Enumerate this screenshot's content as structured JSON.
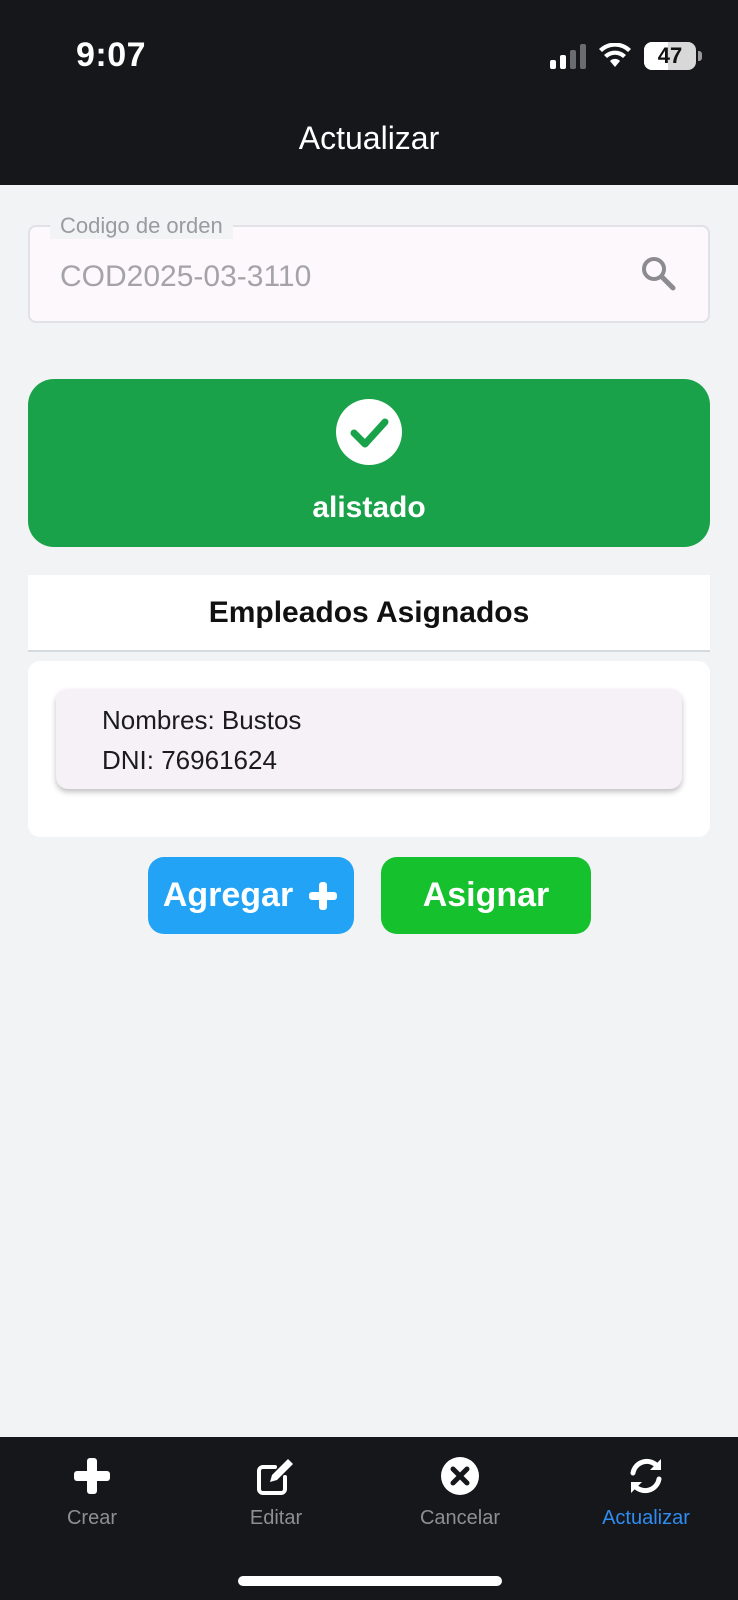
{
  "status_bar": {
    "time": "9:07",
    "battery_level": "47",
    "icons": [
      "signal-icon",
      "wifi-icon",
      "battery-icon"
    ]
  },
  "header": {
    "title": "Actualizar"
  },
  "search": {
    "label": "Codigo de orden",
    "value": "COD2025-03-3110",
    "icon": "search-icon"
  },
  "order_status": {
    "icon": "check-circle-icon",
    "text": "alistado",
    "color": "#1aa24b"
  },
  "employees": {
    "title": "Empleados Asignados",
    "items": [
      {
        "name_line": "Nombres: Bustos",
        "dni_line": "DNI: 76961624"
      }
    ]
  },
  "actions": {
    "add_label": "Agregar",
    "add_color": "#22a3f5",
    "assign_label": "Asignar",
    "assign_color": "#15c12c"
  },
  "tabbar": {
    "active_color": "#2f8cf0",
    "items": [
      {
        "label": "Crear",
        "icon": "plus-icon"
      },
      {
        "label": "Editar",
        "icon": "edit-icon"
      },
      {
        "label": "Cancelar",
        "icon": "cancel-circle-icon"
      },
      {
        "label": "Actualizar",
        "icon": "refresh-icon",
        "active": true
      }
    ]
  }
}
